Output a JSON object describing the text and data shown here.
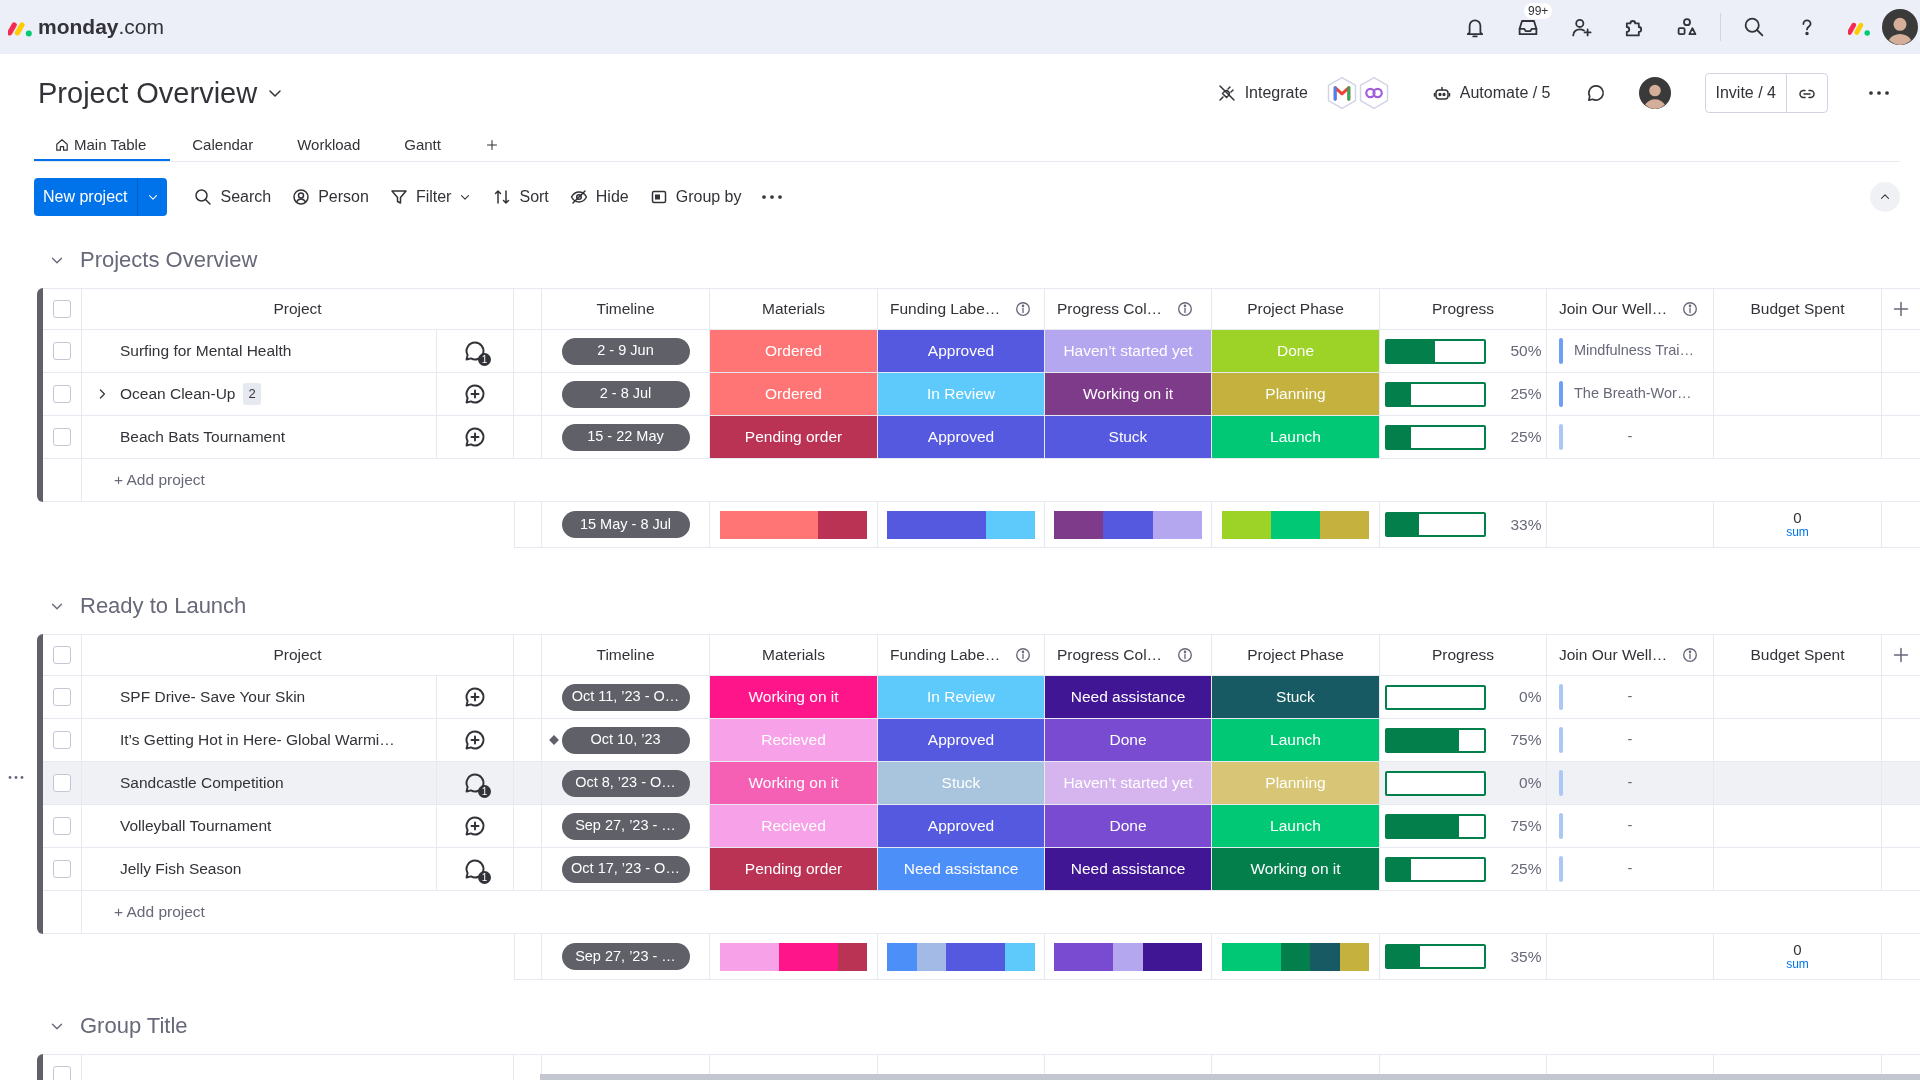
{
  "topbar": {
    "logo": "**monday**.com",
    "inbox_badge": "99+"
  },
  "board": {
    "title": "Project Overview",
    "integrate": "Integrate",
    "automate": "Automate / 5",
    "invite": "Invite / 4",
    "tabs": [
      {
        "label": "Main Table",
        "selected": true
      },
      {
        "label": "Calendar",
        "selected": false
      },
      {
        "label": "Workload",
        "selected": false
      },
      {
        "label": "Gantt",
        "selected": false
      }
    ]
  },
  "toolbar": {
    "new_button": "New project",
    "items": [
      {
        "kind": "search",
        "label": "Search"
      },
      {
        "kind": "person",
        "label": "Person"
      },
      {
        "kind": "filter",
        "label": "Filter"
      },
      {
        "kind": "sort",
        "label": "Sort"
      },
      {
        "kind": "hide",
        "label": "Hide"
      },
      {
        "kind": "group",
        "label": "Group by"
      },
      {
        "kind": "more"
      }
    ]
  },
  "groups": [
    {
      "title": "Projects Overview",
      "all_checked": false,
      "add_row": "+ Add project",
      "columns": [
        {
          "label": "Project",
          "info": false
        },
        {
          "label": "Timeline",
          "info": false
        },
        {
          "label": "Materials",
          "info": false
        },
        {
          "label": "Funding Labe…",
          "info": true
        },
        {
          "label": "Progress Col…",
          "info": true
        },
        {
          "label": "Project Phase",
          "info": false
        },
        {
          "label": "Progress",
          "info": false
        },
        {
          "label": "Join Our Well…",
          "info": true
        },
        {
          "label": "Budget Spent",
          "info": false
        }
      ],
      "rows": [
        {
          "name": "Surfing for Mental Health",
          "checked": false,
          "hovered": false,
          "updates": "1",
          "timeline": "2 - 9 Jun",
          "milestone": false,
          "materials": {
            "label": "Ordered",
            "color": "#ff7575"
          },
          "funding": {
            "label": "Approved",
            "color": "#5559df"
          },
          "status": {
            "label": "Haven’t started yet",
            "color": "#b5a6f0"
          },
          "phase": {
            "label": "Done",
            "color": "#9cd326"
          },
          "level": 0.5,
          "reading": "50%",
          "join": "Mindfulness Trai…",
          "linked": true
        },
        {
          "name": "Ocean Clean-Up",
          "checked": false,
          "hovered": false,
          "subitems": "2",
          "timeline": "2 - 8 Jul",
          "milestone": false,
          "materials": {
            "label": "Ordered",
            "color": "#ff7575"
          },
          "funding": {
            "label": "In Review",
            "color": "#5ecafc"
          },
          "status": {
            "label": "Working on it",
            "color": "#7e3b8a"
          },
          "phase": {
            "label": "Planning",
            "color": "#c4b13e"
          },
          "level": 0.25,
          "reading": "25%",
          "join": "The Breath-Wor…",
          "linked": true
        },
        {
          "name": "Beach Bats Tournament",
          "checked": false,
          "hovered": false,
          "timeline": "15 - 22 May",
          "milestone": false,
          "materials": {
            "label": "Pending order",
            "color": "#bb3354"
          },
          "funding": {
            "label": "Approved",
            "color": "#5559df"
          },
          "status": {
            "label": "Stuck",
            "color": "#5559df"
          },
          "phase": {
            "label": "Launch",
            "color": "#00c875"
          },
          "level": 0.25,
          "reading": "25%",
          "join": "-",
          "linked": false
        }
      ],
      "summary": {
        "timeline": "15 May - 8 Jul",
        "bars": [
          [
            {
              "color": "#ff7575"
            },
            {
              "color": "#ff7575"
            },
            {
              "color": "#bb3354"
            }
          ],
          [
            {
              "color": "#5559df"
            },
            {
              "color": "#5559df"
            },
            {
              "color": "#5ecafc"
            }
          ],
          [
            {
              "color": "#7e3b8a"
            },
            {
              "color": "#5559df"
            },
            {
              "color": "#b5a6f0"
            }
          ],
          [
            {
              "color": "#9cd326"
            },
            {
              "color": "#00c875"
            },
            {
              "color": "#c4b13e"
            }
          ]
        ],
        "level": 0.33,
        "reading": "33%",
        "budget": "0",
        "budget_label": "sum"
      }
    },
    {
      "title": "Ready to Launch",
      "all_checked": false,
      "add_row": "+ Add project",
      "columns": [
        {
          "label": "Project",
          "info": false
        },
        {
          "label": "Timeline",
          "info": false
        },
        {
          "label": "Materials",
          "info": false
        },
        {
          "label": "Funding Labe…",
          "info": true
        },
        {
          "label": "Progress Col…",
          "info": true
        },
        {
          "label": "Project Phase",
          "info": false
        },
        {
          "label": "Progress",
          "info": false
        },
        {
          "label": "Join Our Well…",
          "info": true
        },
        {
          "label": "Budget Spent",
          "info": false
        }
      ],
      "rows": [
        {
          "name": "SPF Drive- Save Your Skin",
          "checked": false,
          "hovered": false,
          "timeline": "Oct 11, ’23 - O…",
          "milestone": false,
          "materials": {
            "label": "Working on it",
            "color": "#ff158a"
          },
          "funding": {
            "label": "In Review",
            "color": "#5ecafc"
          },
          "status": {
            "label": "Need assistance",
            "color": "#401694"
          },
          "phase": {
            "label": "Stuck",
            "color": "#175a63"
          },
          "level": 0,
          "reading": "0%",
          "join": "-",
          "linked": false
        },
        {
          "name": "It’s Getting Hot in Here- Global Warmi…",
          "checked": false,
          "hovered": false,
          "timeline": "Oct 10, ’23",
          "milestone": true,
          "materials": {
            "label": "Recieved",
            "color": "#f7a2e8"
          },
          "funding": {
            "label": "Approved",
            "color": "#5559df"
          },
          "status": {
            "label": "Done",
            "color": "#784bd1"
          },
          "phase": {
            "label": "Launch",
            "color": "#00c875"
          },
          "level": 0.75,
          "reading": "75%",
          "join": "-",
          "linked": false
        },
        {
          "name": "Sandcastle Competition",
          "checked": false,
          "hovered": true,
          "updates": "1",
          "timeline": "Oct 8, ’23 - O…",
          "milestone": false,
          "materials": {
            "label": "Working on it",
            "color": "#f55fb4"
          },
          "funding": {
            "label": "Stuck",
            "color": "#a9c5dd"
          },
          "status": {
            "label": "Haven’t started yet",
            "color": "#d6b5ee"
          },
          "phase": {
            "label": "Planning",
            "color": "#d8c676"
          },
          "level": 0,
          "reading": "0%",
          "join": "-",
          "linked": false
        },
        {
          "name": "Volleyball Tournament",
          "checked": false,
          "hovered": false,
          "timeline": "Sep 27, ’23 - …",
          "milestone": false,
          "materials": {
            "label": "Recieved",
            "color": "#f7a2e8"
          },
          "funding": {
            "label": "Approved",
            "color": "#5559df"
          },
          "status": {
            "label": "Done",
            "color": "#784bd1"
          },
          "phase": {
            "label": "Launch",
            "color": "#00c875"
          },
          "level": 0.75,
          "reading": "75%",
          "join": "-",
          "linked": false
        },
        {
          "name": "Jelly Fish Season",
          "checked": false,
          "hovered": false,
          "updates": "1",
          "timeline": "Oct 17, ’23 - O…",
          "milestone": false,
          "materials": {
            "label": "Pending order",
            "color": "#bb3354"
          },
          "funding": {
            "label": "Need assistance",
            "color": "#4d8ff8"
          },
          "status": {
            "label": "Need assistance",
            "color": "#401694"
          },
          "phase": {
            "label": "Working on it",
            "color": "#037f4c"
          },
          "level": 0.25,
          "reading": "25%",
          "join": "-",
          "linked": false
        }
      ],
      "summary": {
        "timeline": "Sep 27, ’23 - …",
        "bars": [
          [
            {
              "color": "#f7a2e8"
            },
            {
              "color": "#f7a2e8"
            },
            {
              "color": "#ff158a"
            },
            {
              "color": "#ff158a"
            },
            {
              "color": "#bb3354"
            }
          ],
          [
            {
              "color": "#4d8ff8"
            },
            {
              "color": "#a3b9e6"
            },
            {
              "color": "#5559df"
            },
            {
              "color": "#5559df"
            },
            {
              "color": "#5ecafc"
            }
          ],
          [
            {
              "color": "#784bd1"
            },
            {
              "color": "#784bd1"
            },
            {
              "color": "#b5a6f0"
            },
            {
              "color": "#401694"
            },
            {
              "color": "#401694"
            }
          ],
          [
            {
              "color": "#00c875"
            },
            {
              "color": "#00c875"
            },
            {
              "color": "#037f4c"
            },
            {
              "color": "#175a63"
            },
            {
              "color": "#c4b13e"
            }
          ]
        ],
        "level": 0.35,
        "reading": "35%",
        "budget": "0",
        "budget_label": "sum"
      }
    },
    {
      "title": "Group Title",
      "all_checked": false
    }
  ]
}
